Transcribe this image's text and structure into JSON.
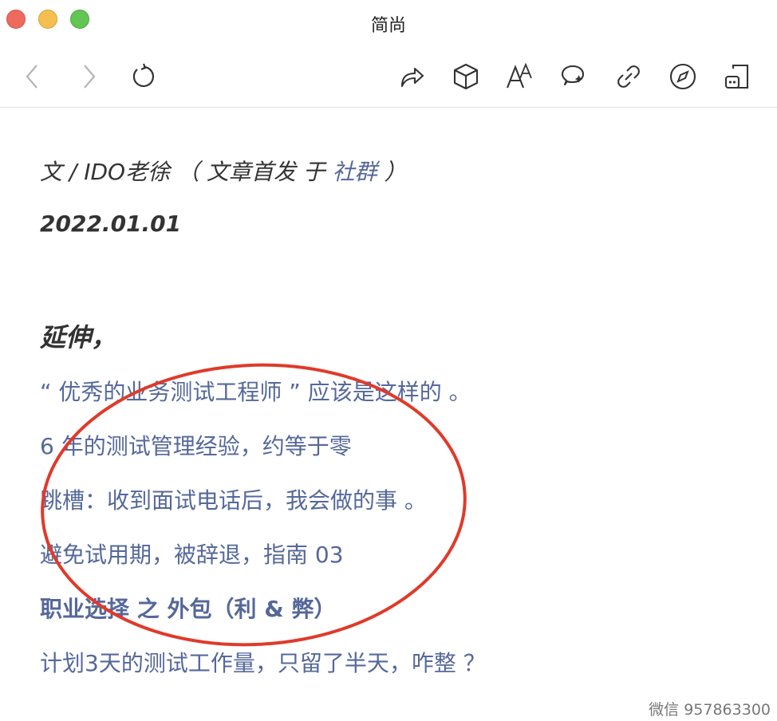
{
  "window": {
    "title": "简尚"
  },
  "toolbar": {
    "icons": [
      "chevron-left-icon",
      "chevron-right-icon",
      "refresh-icon",
      "share-icon",
      "box-icon",
      "font-icon",
      "chat-icon",
      "link-icon",
      "compass-icon",
      "note-icon"
    ]
  },
  "article": {
    "byline_prefix": "文 / IDO老徐 （ 文章首发 于 ",
    "byline_link": "社群",
    "byline_suffix": " ）",
    "date": "2022.01.01",
    "heading": "延伸，",
    "links": [
      "“ 优秀的业务测试工程师 ” 应该是这样的 。",
      "6 年的测试管理经验，约等于零",
      "跳槽：收到面试电话后，我会做的事 。",
      "避免试用期，被辞退，指南 03",
      "职业选择 之 外包（利 & 弊）",
      "计划3天的测试工作量，只留了半天，咋整 ？"
    ]
  },
  "annotation": {
    "color": "#e03a2a"
  },
  "watermark": "微信 957863300",
  "colors": {
    "link": "#55689a",
    "text": "#333333"
  }
}
